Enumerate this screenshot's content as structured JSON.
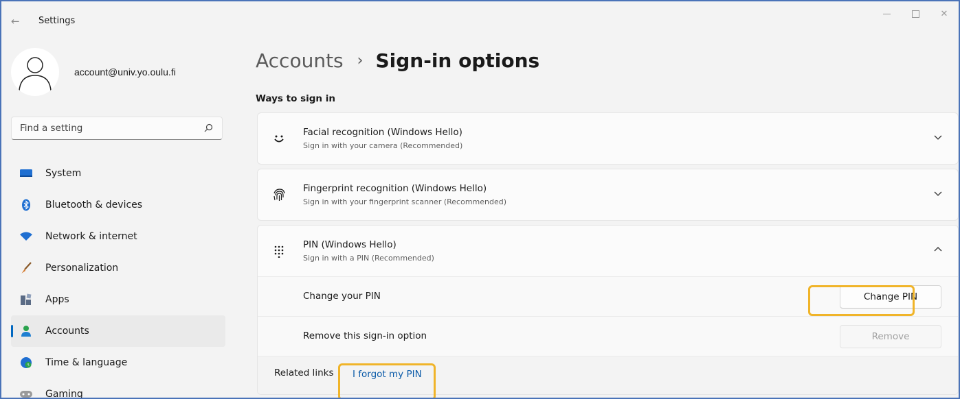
{
  "window": {
    "title": "Settings"
  },
  "profile": {
    "email": "account@univ.yo.oulu.fi"
  },
  "search": {
    "placeholder": "Find a setting"
  },
  "sidebar": {
    "items": [
      {
        "label": "System",
        "icon": "system-icon",
        "color": "#1f6fd1",
        "active": false
      },
      {
        "label": "Bluetooth & devices",
        "icon": "bluetooth-icon",
        "color": "#1f6fd1",
        "active": false
      },
      {
        "label": "Network & internet",
        "icon": "wifi-icon",
        "color": "#1f6fd1",
        "active": false
      },
      {
        "label": "Personalization",
        "icon": "brush-icon",
        "color": "#d4782a",
        "active": false
      },
      {
        "label": "Apps",
        "icon": "apps-icon",
        "color": "#5a6b85",
        "active": false
      },
      {
        "label": "Accounts",
        "icon": "accounts-icon",
        "color": "#2aa34d",
        "active": true
      },
      {
        "label": "Time & language",
        "icon": "globe-clock-icon",
        "color": "#1f6fd1",
        "active": false
      },
      {
        "label": "Gaming",
        "icon": "gamepad-icon",
        "color": "#8a8a8a",
        "active": false
      }
    ]
  },
  "header": {
    "parent": "Accounts",
    "separator": "›",
    "current": "Sign-in options"
  },
  "section": {
    "title": "Ways to sign in"
  },
  "options": {
    "facial": {
      "title": "Facial recognition (Windows Hello)",
      "subtitle": "Sign in with your camera (Recommended)"
    },
    "fingerprint": {
      "title": "Fingerprint recognition (Windows Hello)",
      "subtitle": "Sign in with your fingerprint scanner (Recommended)"
    },
    "pin": {
      "title": "PIN (Windows Hello)",
      "subtitle": "Sign in with a PIN (Recommended)",
      "change_label": "Change your PIN",
      "change_button": "Change PIN",
      "remove_label": "Remove this sign-in option",
      "remove_button": "Remove",
      "related_label": "Related links",
      "forgot_link": "I forgot my PIN"
    }
  },
  "colors": {
    "accent": "#0067c0",
    "highlight": "#f0b429",
    "window_border": "#4a73b8"
  }
}
